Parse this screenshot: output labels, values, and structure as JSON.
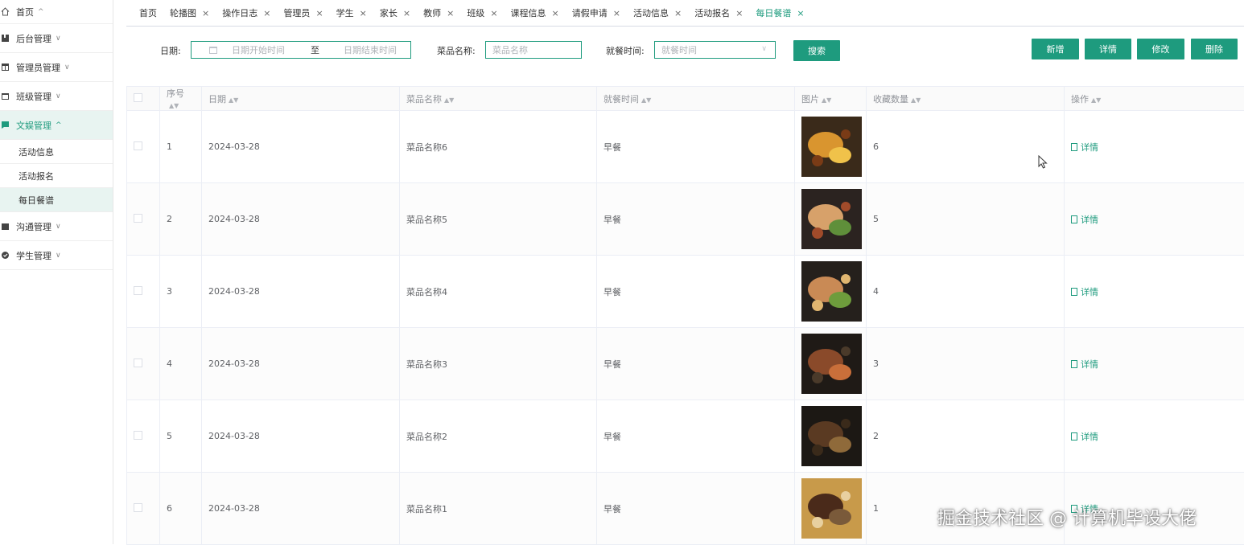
{
  "sidebar": {
    "items": [
      {
        "label": "首页",
        "icon": "home-icon",
        "chev": "^"
      },
      {
        "label": "后台管理",
        "icon": "book-icon",
        "chev": "v"
      },
      {
        "label": "管理员管理",
        "icon": "table-icon",
        "chev": "v"
      },
      {
        "label": "班级管理",
        "icon": "folder-icon",
        "chev": "v"
      },
      {
        "label": "文娱管理",
        "icon": "chat-icon",
        "chev": "^"
      },
      {
        "label": "沟通管理",
        "icon": "folder-icon",
        "chev": "v"
      },
      {
        "label": "学生管理",
        "icon": "check-circle-icon",
        "chev": "v"
      }
    ],
    "sub_items": [
      "活动信息",
      "活动报名",
      "每日餐谱"
    ]
  },
  "tabs": [
    "首页",
    "轮播图",
    "操作日志",
    "管理员",
    "学生",
    "家长",
    "教师",
    "班级",
    "课程信息",
    "请假申请",
    "活动信息",
    "活动报名",
    "每日餐谱"
  ],
  "filter": {
    "date_label": "日期:",
    "date_start_placeholder": "日期开始时间",
    "date_sep": "至",
    "date_end_placeholder": "日期结束时间",
    "dish_label": "菜品名称:",
    "dish_placeholder": "菜品名称",
    "meal_label": "就餐时间:",
    "meal_placeholder": "就餐时间",
    "search_label": "搜索"
  },
  "actions": {
    "add": "新增",
    "detail": "详情",
    "edit": "修改",
    "delete": "删除"
  },
  "table": {
    "headers": [
      "序号",
      "日期",
      "菜品名称",
      "就餐时间",
      "图片",
      "收藏数量",
      "操作"
    ],
    "rows": [
      {
        "no": "1",
        "date": "2024-03-28",
        "name": "菜品名称6",
        "meal": "早餐",
        "fav": "6",
        "op": "详情"
      },
      {
        "no": "2",
        "date": "2024-03-28",
        "name": "菜品名称5",
        "meal": "早餐",
        "fav": "5",
        "op": "详情"
      },
      {
        "no": "3",
        "date": "2024-03-28",
        "name": "菜品名称4",
        "meal": "早餐",
        "fav": "4",
        "op": "详情"
      },
      {
        "no": "4",
        "date": "2024-03-28",
        "name": "菜品名称3",
        "meal": "早餐",
        "fav": "3",
        "op": "详情"
      },
      {
        "no": "5",
        "date": "2024-03-28",
        "name": "菜品名称2",
        "meal": "早餐",
        "fav": "2",
        "op": "详情"
      },
      {
        "no": "6",
        "date": "2024-03-28",
        "name": "菜品名称1",
        "meal": "早餐",
        "fav": "1",
        "op": "详情"
      }
    ]
  },
  "watermark": "掘金技术社区 @ 计算机毕设大佬",
  "colors": {
    "accent": "#1e9b7e",
    "active_bg": "#e8f4f1"
  }
}
